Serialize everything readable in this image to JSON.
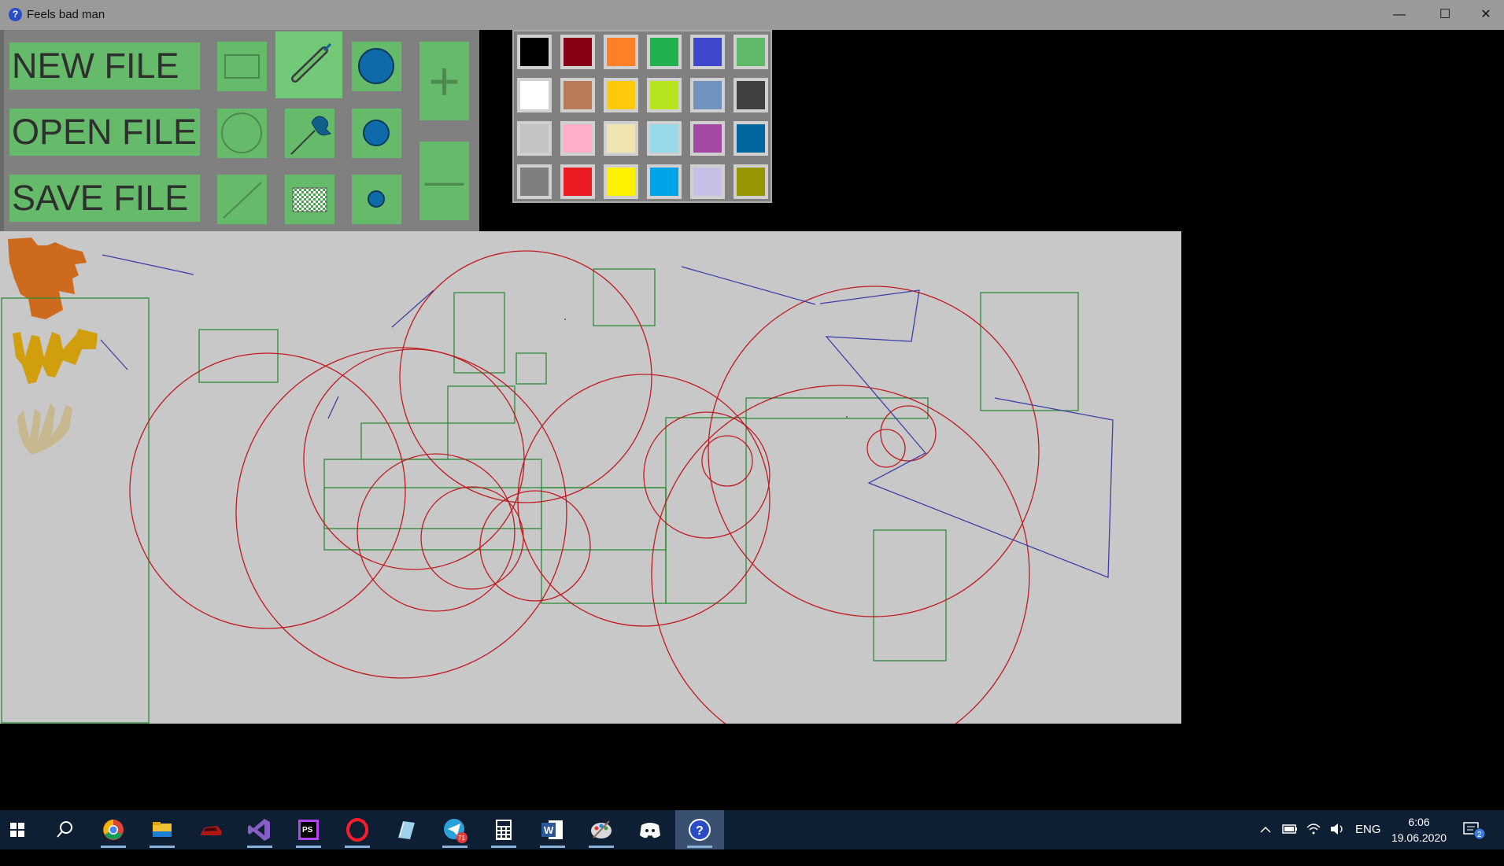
{
  "window": {
    "title": "Feels bad man",
    "title_icon": "?"
  },
  "window_controls": {
    "minimize": "—",
    "maximize": "☐",
    "close": "✕"
  },
  "file_buttons": {
    "new": "NEW FILE",
    "open": "OPEN FILE",
    "save": "SAVE FILE"
  },
  "zoom": {
    "plus": "+",
    "minus": "—"
  },
  "tools": [
    "rectangle-tool",
    "line-brush-tool",
    "brush-size-large",
    "circle-tool",
    "pipette-tool",
    "brush-size-medium",
    "line-tool",
    "fill-pattern-tool",
    "brush-size-small"
  ],
  "selected_tool": "line-brush-tool",
  "palette": {
    "colors": [
      "#000000",
      "#880015",
      "#ff7f27",
      "#22b14c",
      "#3f48cc",
      "#5fbb6a",
      "#ffffff",
      "#b97a57",
      "#ffc90e",
      "#b5e61d",
      "#7092be",
      "#404040",
      "#c3c3c3",
      "#ffaec9",
      "#efe4b0",
      "#99d9ea",
      "#a349a4",
      "#00669e",
      "#7f7f7f",
      "#ed1c24",
      "#fff200",
      "#00a2e8",
      "#c8bfe7",
      "#969600"
    ],
    "selected": "#000000"
  },
  "drawing_colors": {
    "canvas": "#c8c8c8",
    "circle": "#c01b20",
    "rect": "#2e8b3a",
    "line": "#3b3fa8"
  },
  "taskbar": {
    "apps": [
      "windows-start-icon",
      "search-icon",
      "chrome-icon",
      "file-explorer-icon",
      "red-car-app-icon",
      "visual-studio-icon",
      "phpstorm-icon",
      "opera-icon",
      "notes-app-icon",
      "telegram-icon",
      "calculator-icon",
      "word-icon",
      "paint-icon",
      "discord-icon",
      "help-app-icon"
    ],
    "labels": {
      "phpstorm": "PS",
      "word": "W",
      "help": "?"
    },
    "telegram_badge": "71",
    "language": "ENG",
    "time": "6:06",
    "date": "19.06.2020",
    "notifications": "2"
  }
}
